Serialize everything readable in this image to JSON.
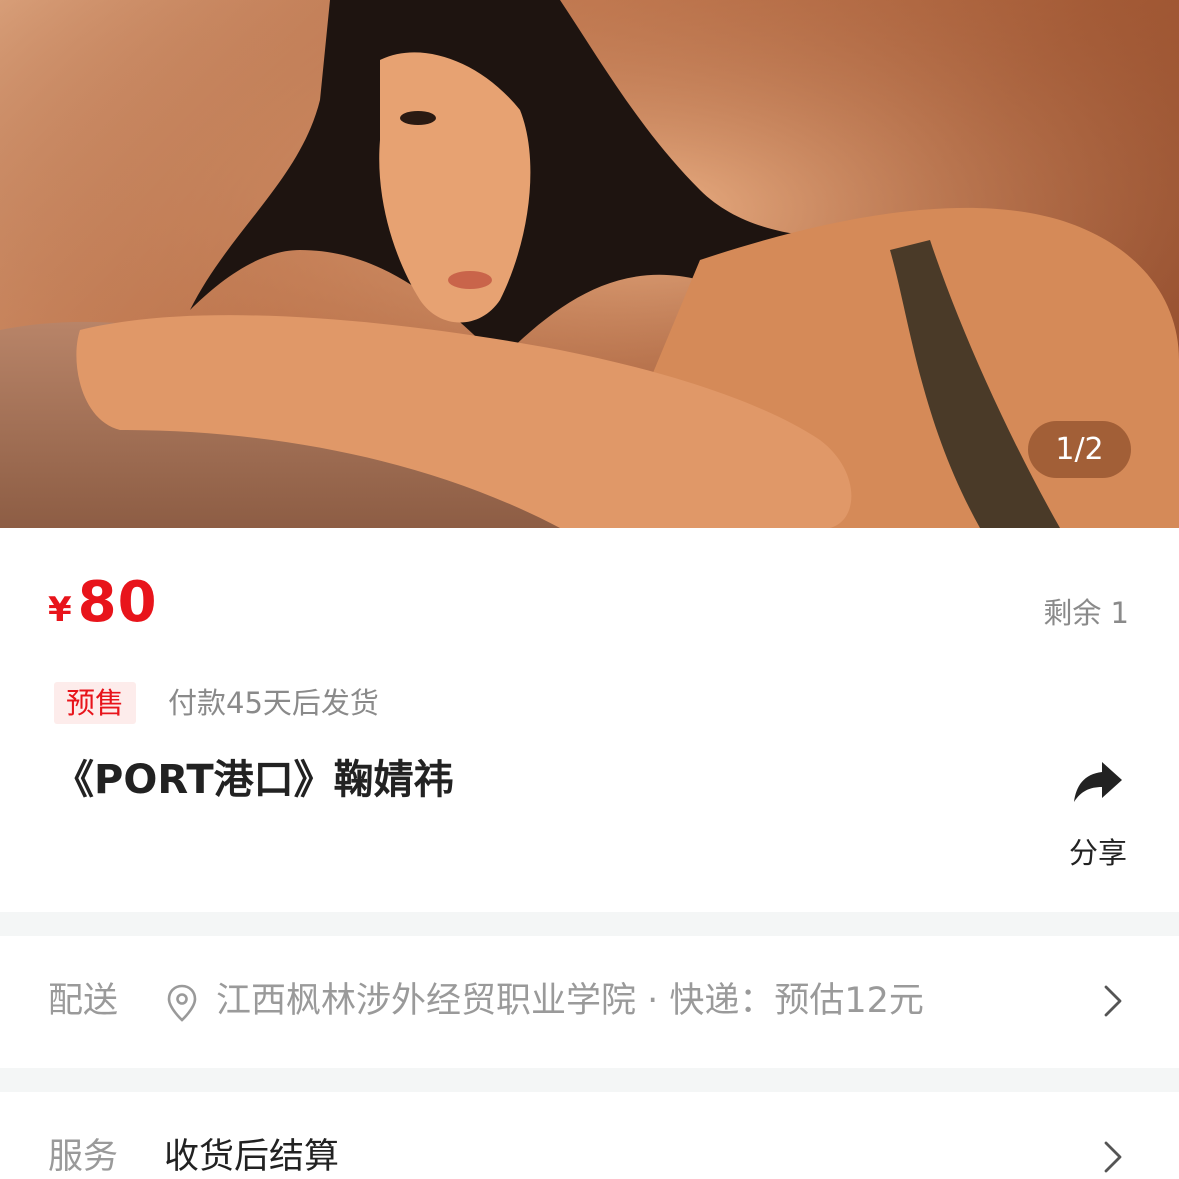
{
  "gallery": {
    "indicator": "1/2"
  },
  "product": {
    "currency": "¥",
    "price": "80",
    "stock": "剩余 1",
    "presale_tag": "预售",
    "ship_note": "付款45天后发货",
    "title": "《PORT港口》鞠婧祎"
  },
  "share": {
    "label": "分享",
    "icon": "share-arrow-icon"
  },
  "delivery": {
    "label": "配送",
    "icon": "location-pin-icon",
    "text": "江西枫林涉外经贸职业学院 · 快递：预估12元"
  },
  "service": {
    "label": "服务",
    "text": "收货后结算"
  },
  "colors": {
    "price": "#e8141b",
    "presale_bg": "#fdeceb",
    "muted": "#8a8a8a",
    "separator": "#f4f6f6"
  }
}
